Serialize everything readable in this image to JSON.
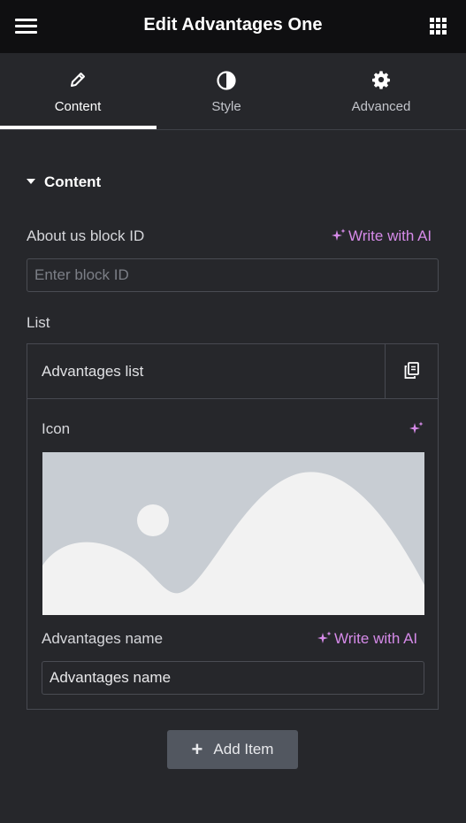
{
  "header": {
    "title": "Edit Advantages One",
    "menu_icon": "hamburger-menu-icon",
    "apps_icon": "apps-grid-icon"
  },
  "tabs": [
    {
      "label": "Content",
      "icon": "pencil-icon",
      "active": true
    },
    {
      "label": "Style",
      "icon": "contrast-icon",
      "active": false
    },
    {
      "label": "Advanced",
      "icon": "gear-icon",
      "active": false
    }
  ],
  "section": {
    "title": "Content"
  },
  "block_id": {
    "label": "About us block ID",
    "ai_label": "Write with AI",
    "value": "",
    "placeholder": "Enter block ID"
  },
  "list": {
    "label": "List",
    "repeater_title": "Advantages list",
    "duplicate_icon": "copy-icon",
    "icon_label": "Icon",
    "image_placeholder_icon": "image-placeholder",
    "name_label": "Advantages name",
    "name_ai_label": "Write with AI",
    "name_value": "Advantages name"
  },
  "add_item": {
    "label": "Add Item"
  },
  "colors": {
    "background": "#26272b",
    "topbar": "#0f0f11",
    "accent_ai": "#d58ae8",
    "button": "#525760"
  }
}
